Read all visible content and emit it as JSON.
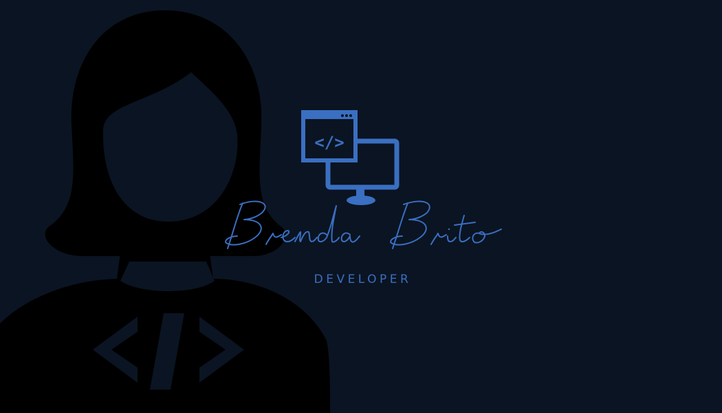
{
  "brand": {
    "name": "Brenda Brito",
    "role": "DEVELOPER"
  },
  "icons": {
    "background": "developer-woman-silhouette-icon",
    "logo": "code-window-monitor-icon",
    "logo_code_text": "</>"
  },
  "colors": {
    "background": "#0b1422",
    "silhouette": "#000000",
    "accent": "#3a6fc1",
    "silhouette_code": "#0b1422"
  }
}
